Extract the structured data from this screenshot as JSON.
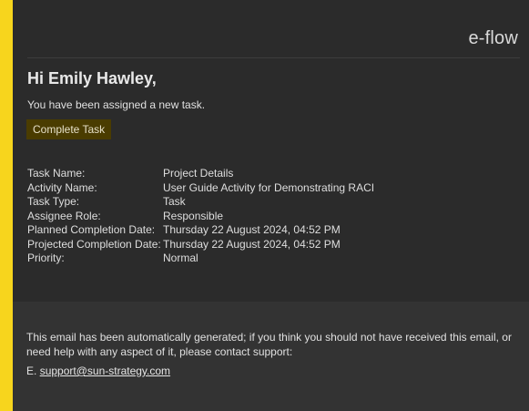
{
  "brand": {
    "name": "e-flow",
    "accent_color": "#f7d51d"
  },
  "greeting": "Hi Emily Hawley,",
  "intro": "You have been assigned a new task.",
  "cta": {
    "label": "Complete Task",
    "background": "#4a3c00"
  },
  "details": [
    {
      "label": "Task Name:",
      "value": "Project Details"
    },
    {
      "label": "Activity Name:",
      "value": "User Guide Activity for Demonstrating RACI"
    },
    {
      "label": "Task Type:",
      "value": "Task"
    },
    {
      "label": "Assignee Role:",
      "value": "Responsible"
    },
    {
      "label": "Planned Completion Date:",
      "value": "Thursday 22 August 2024, 04:52 PM"
    },
    {
      "label": "Projected Completion Date:",
      "value": "Thursday 22 August 2024, 04:52 PM"
    },
    {
      "label": "Priority:",
      "value": "Normal"
    }
  ],
  "footer": {
    "notice": "This email has been automatically generated; if you think you should not have received this email, or need help with any aspect of it, please contact support:",
    "email_prefix": "E.",
    "email": "support@sun-strategy.com"
  }
}
